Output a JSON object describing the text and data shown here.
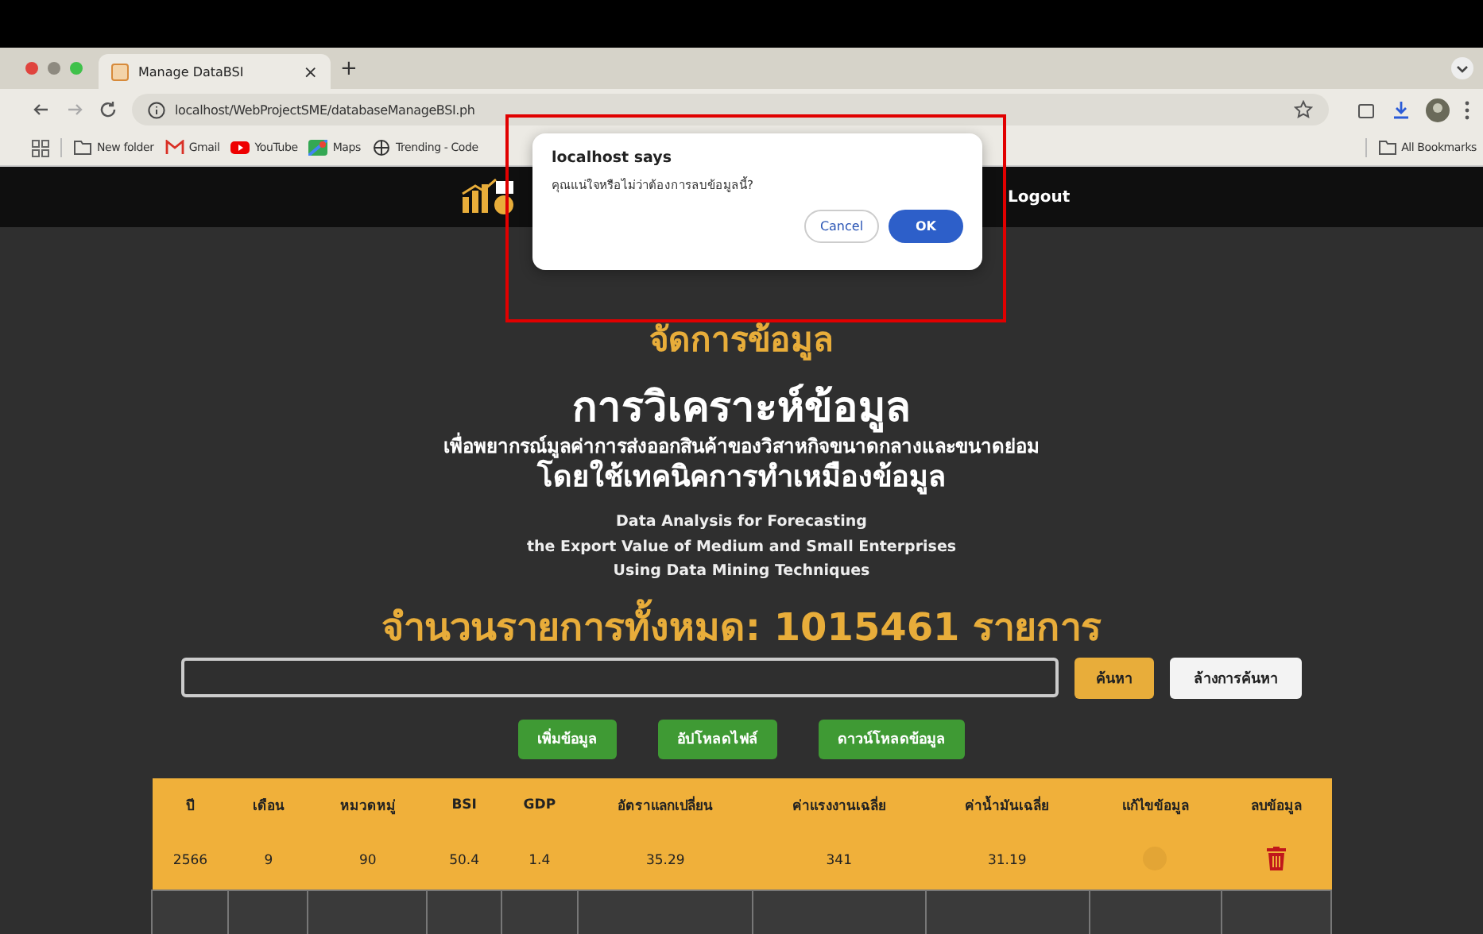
{
  "browser": {
    "tab": {
      "title": "Manage DataBSI",
      "close": "×"
    },
    "new_tab": "+",
    "url": "localhost/WebProjectSME/databaseManageBSI.ph",
    "bookmarks": [
      {
        "label": "New folder",
        "kind": "folder"
      },
      {
        "label": "Gmail",
        "kind": "gmail"
      },
      {
        "label": "YouTube",
        "kind": "youtube"
      },
      {
        "label": "Maps",
        "kind": "maps"
      },
      {
        "label": "Trending - Code",
        "kind": "trending"
      }
    ],
    "all_bookmarks": "All Bookmarks"
  },
  "site_nav": {
    "logout": "Logout"
  },
  "page": {
    "heading": "จัดการข้อมูล",
    "title": "การวิเคราะห์ข้อมูล",
    "subtitle_lines": [
      "เพื่อพยากรณ์มูลค่าการส่งออกสินค้าของวิสาหกิจขนาดกลางและขนาดย่อม",
      "โดยใช้เทคนิคการทำเหมืองข้อมูล"
    ],
    "english_lines": [
      "Data Analysis for Forecasting",
      "the Export Value of Medium and Small Enterprises",
      "Using Data Mining Techniques"
    ],
    "count": "จำนวนรายการทั้งหมด: 1015461 รายการ"
  },
  "search": {
    "button": "ค้นหา",
    "clear": "ล้างการค้นหา"
  },
  "actions": [
    "เพิ่มข้อมูล",
    "อัปโหลดไฟล์",
    "ดาวน์โหลดข้อมูล"
  ],
  "table": {
    "columns": [
      "ปี",
      "เดือน",
      "หมวดหมู่",
      "BSI",
      "GDP",
      "อัตราแลกเปลี่ยน",
      "ค่าแรงงานเฉลี่ย",
      "ค่าน้ำมันเฉลี่ย",
      "แก้ไขข้อมูล",
      "ลบข้อมูล"
    ],
    "rows": [
      {
        "cells": [
          "2566",
          "9",
          "90",
          "50.4",
          "1.4",
          "35.29",
          "341",
          "31.19"
        ],
        "edit_enabled": false
      }
    ]
  },
  "dialog": {
    "title": "localhost says",
    "message": "คุณแน่ใจหรือไม่ว่าต้องการลบข้อมูลนี้?",
    "buttons": [
      {
        "label": "Cancel",
        "kind": "secondary"
      },
      {
        "label": "OK",
        "kind": "primary"
      }
    ]
  }
}
